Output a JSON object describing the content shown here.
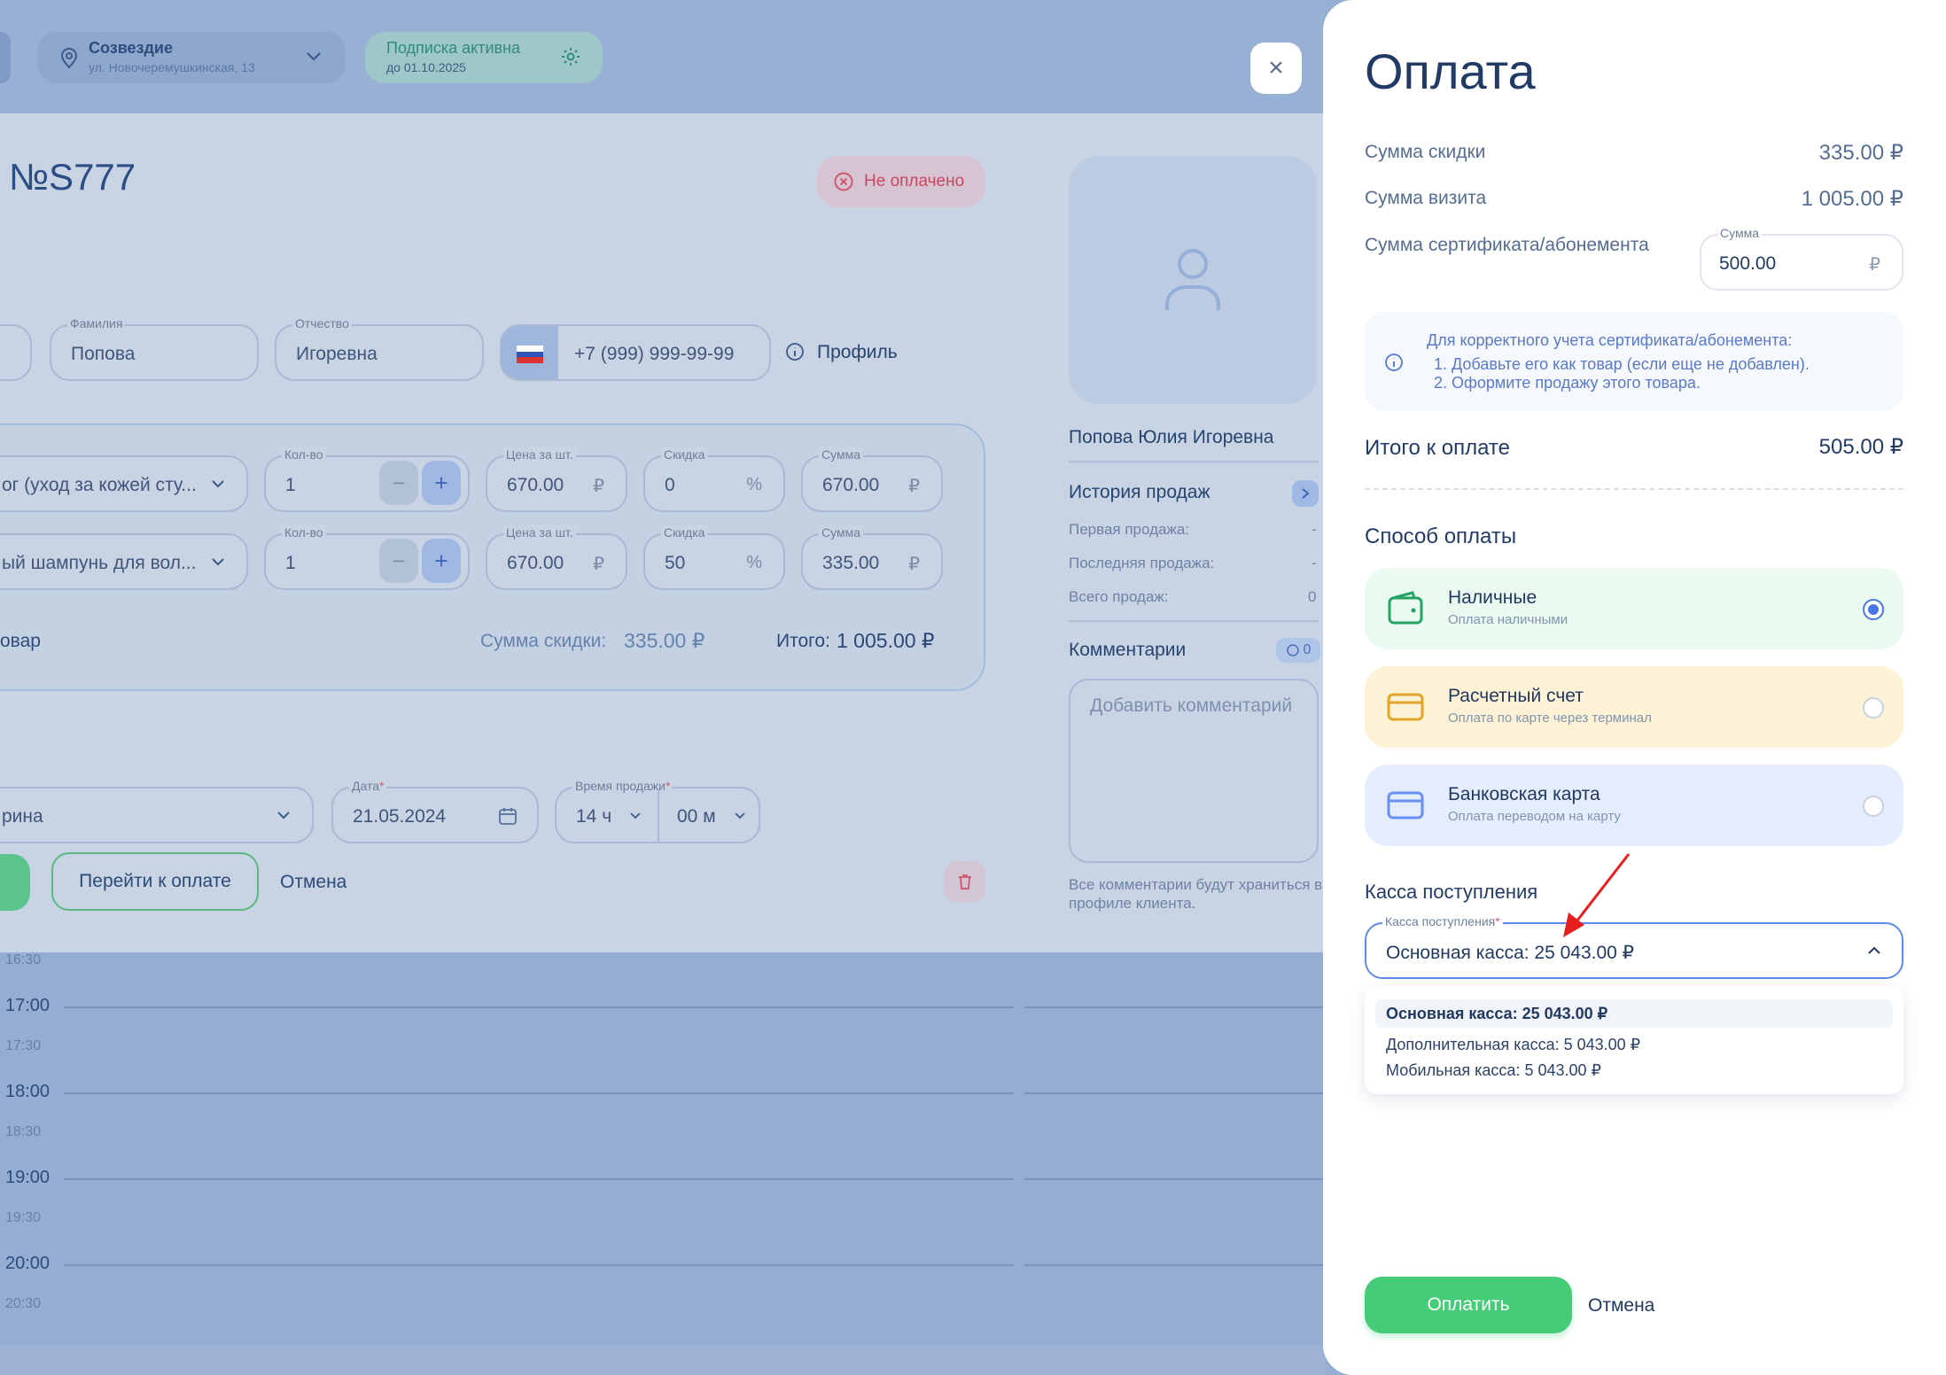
{
  "header": {
    "location_title": "Созвездие",
    "location_address": "ул. Новочеремушкинская, 13",
    "subscription_title": "Подписка активна",
    "subscription_until": "до 01.10.2025"
  },
  "sale": {
    "title": "№S777",
    "status": "Не оплачено",
    "client": {
      "last_name_label": "Фамилия",
      "last_name": "Попова",
      "patronymic_label": "Отчество",
      "patronymic": "Игоревна",
      "phone": "+7 (999) 999-99-99",
      "profile_link": "Профиль"
    },
    "items": [
      {
        "name": "ог (уход за кожей сту...",
        "qty_label": "Кол-во",
        "qty": "1",
        "price_label": "Цена за шт.",
        "price": "670.00",
        "currency": "₽",
        "discount_label": "Скидка",
        "discount": "0",
        "discount_unit": "%",
        "sum_label": "Сумма",
        "sum": "670.00"
      },
      {
        "name": "ый шампунь для вол...",
        "qty_label": "Кол-во",
        "qty": "1",
        "price_label": "Цена за шт.",
        "price": "670.00",
        "currency": "₽",
        "discount_label": "Скидка",
        "discount": "50",
        "discount_unit": "%",
        "sum_label": "Сумма",
        "sum": "335.00"
      }
    ],
    "add_item": "овар",
    "discount_total_label": "Сумма скидки:",
    "discount_total": "335.00 ₽",
    "total_label": "Итого:",
    "total": "1 005.00 ₽",
    "employee": "рина",
    "date_label": "Дата",
    "date": "21.05.2024",
    "time_label": "Время продажи",
    "hour": "14 ч",
    "minute": "00 м",
    "go_to_payment": "Перейти к оплате",
    "cancel": "Отмена"
  },
  "client_card": {
    "full_name": "Попова Юлия Игоревна",
    "history_title": "История продаж",
    "first_sale_label": "Первая продажа:",
    "first_sale": "-",
    "last_sale_label": "Последняя продажа:",
    "last_sale": "-",
    "total_sales_label": "Всего продаж:",
    "total_sales": "0",
    "comments_title": "Комментарии",
    "comments_count": "0",
    "comment_placeholder": "Добавить комментарий",
    "comment_note": "Все комментарии будут храниться в профиле клиента."
  },
  "timeline": [
    {
      "label": "16:30",
      "half": true
    },
    {
      "label": "17:00",
      "half": false
    },
    {
      "label": "17:30",
      "half": true
    },
    {
      "label": "18:00",
      "half": false
    },
    {
      "label": "18:30",
      "half": true
    },
    {
      "label": "19:00",
      "half": false
    },
    {
      "label": "19:30",
      "half": true
    },
    {
      "label": "20:00",
      "half": false
    },
    {
      "label": "20:30",
      "half": true
    }
  ],
  "payment": {
    "title": "Оплата",
    "discount_label": "Сумма скидки",
    "discount_value": "335.00 ₽",
    "visit_label": "Сумма визита",
    "visit_value": "1 005.00 ₽",
    "certificate_label": "Сумма сертификата/абонемента",
    "certificate_field_label": "Сумма",
    "certificate_value": "500.00",
    "currency": "₽",
    "info_lines": [
      "Для корректного учета сертификата/абонемента:",
      "1. Добавьте его как товар (если еще не добавлен).",
      "2. Оформите продажу этого товара."
    ],
    "total_label": "Итого к оплате",
    "total_value": "505.00 ₽",
    "method_title": "Способ оплаты",
    "methods": [
      {
        "title": "Наличные",
        "subtitle": "Оплата наличными",
        "selected": true,
        "color": "#eafaf1"
      },
      {
        "title": "Расчетный счет",
        "subtitle": "Оплата по карте через терминал",
        "selected": false,
        "color": "#fdf2d5"
      },
      {
        "title": "Банковская карта",
        "subtitle": "Оплата переводом на карту",
        "selected": false,
        "color": "#e3edfd"
      }
    ],
    "register_title": "Касса поступления",
    "register_field_label": "Касса поступления",
    "register_value": "Основная касса: 25 043.00 ₽",
    "register_options": [
      "Основная касса: 25 043.00 ₽",
      "Дополнительная касса: 5 043.00 ₽",
      "Мобильная касса: 5 043.00 ₽"
    ],
    "pay_button": "Оплатить",
    "cancel_button": "Отмена"
  },
  "colors": {
    "accent_green": "#46cc79",
    "accent_blue": "#4a77e8",
    "status_red": "#d2566b"
  }
}
